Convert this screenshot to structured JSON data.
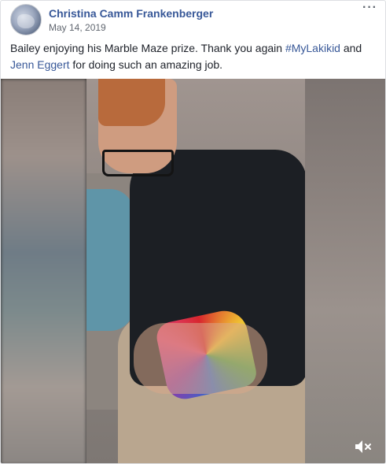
{
  "post": {
    "author": "Christina Camm Frankenberger",
    "date": "May 14, 2019",
    "more_icon": "more-options-icon",
    "text_part1": "Bailey enjoying his Marble Maze prize. Thank you again ",
    "hashtag": "#MyLakikid",
    "text_part2": " and ",
    "mention": "Jenn Eggert",
    "text_part3": " for doing such an amazing job."
  },
  "video": {
    "description_icon": "video-thumbnail",
    "mute_icon": "volume-muted-icon"
  },
  "colors": {
    "link": "#385898",
    "text": "#1d2129",
    "meta": "#616770"
  }
}
